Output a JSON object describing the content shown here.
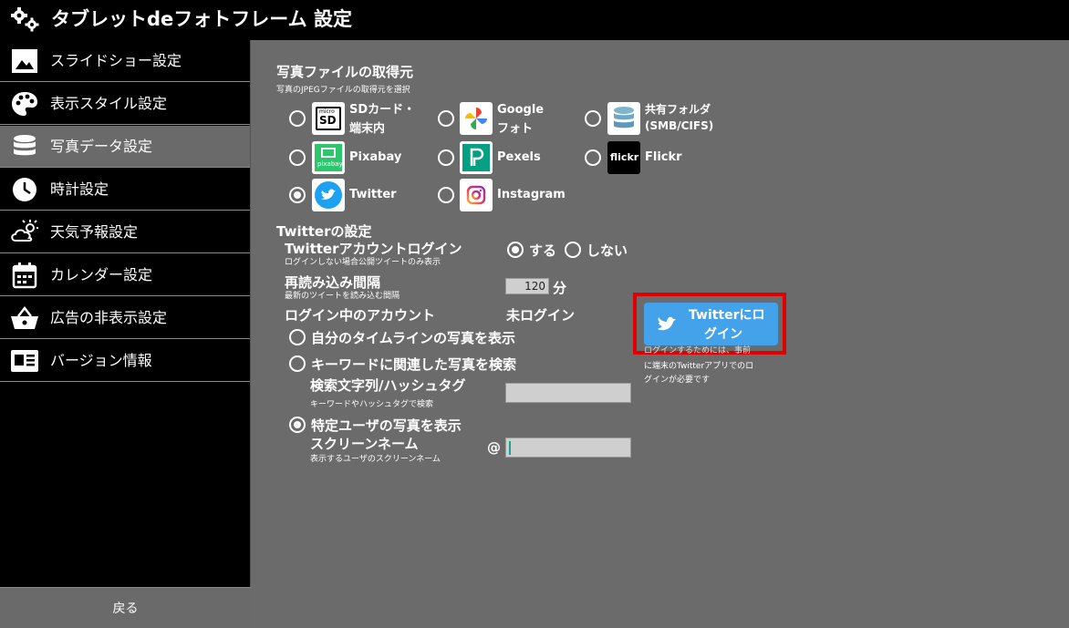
{
  "window": {
    "title": "タブレットdeフォトフレーム 設定"
  },
  "sidebar": {
    "items": [
      {
        "label": "スライドショー設定",
        "icon": "image-icon"
      },
      {
        "label": "表示スタイル設定",
        "icon": "palette-icon"
      },
      {
        "label": "写真データ設定",
        "icon": "database-icon"
      },
      {
        "label": "時計設定",
        "icon": "clock-icon"
      },
      {
        "label": "天気予報設定",
        "icon": "weather-icon"
      },
      {
        "label": "カレンダー設定",
        "icon": "calendar-icon"
      },
      {
        "label": "広告の非表示設定",
        "icon": "basket-icon"
      },
      {
        "label": "バージョン情報",
        "icon": "info-card-icon"
      }
    ],
    "back_label": "戻る"
  },
  "source": {
    "title": "写真ファイルの取得元",
    "subtitle": "写真のJPEGファイルの取得元を選択",
    "options": [
      {
        "line1": "SDカード・",
        "line2": "端末内",
        "icon": "sd-card-icon",
        "selected": false
      },
      {
        "line1": "Google",
        "line2": "フォト",
        "icon": "google-photos-icon",
        "selected": false
      },
      {
        "line1": "共有フォルダ",
        "line2": "(SMB/CIFS)",
        "icon": "shared-folder-icon",
        "selected": false
      },
      {
        "line1": "Pixabay",
        "icon": "pixabay-icon",
        "selected": false
      },
      {
        "line1": "Pexels",
        "icon": "pexels-icon",
        "selected": false
      },
      {
        "line1": "Flickr",
        "icon": "flickr-icon",
        "selected": false
      },
      {
        "line1": "Twitter",
        "icon": "twitter-icon",
        "selected": true
      },
      {
        "line1": "Instagram",
        "icon": "instagram-icon",
        "selected": false
      }
    ],
    "sd_tile_text": {
      "top": "micro",
      "main": "SD"
    },
    "pixabay_tile_text": "pixabay",
    "flickr_tile_text": "flickr"
  },
  "twitter": {
    "section_title": "Twitterの設定",
    "account_login": {
      "label": "Twitterアカウントログイン",
      "sub": "ログインしない場合公開ツイートのみ表示",
      "yes": "する",
      "no": "しない",
      "selected": "yes"
    },
    "reload": {
      "label": "再読み込み間隔",
      "sub": "最新のツイートを読み込む間隔",
      "value": "120",
      "unit": "分"
    },
    "current_account": {
      "label": "ログイン中のアカウント",
      "value": "未ログイン"
    },
    "mode_timeline": "自分のタイムラインの写真を表示",
    "mode_keyword": "キーワードに関連した写真を検索",
    "search": {
      "label": "検索文字列/ハッシュタグ",
      "sub": "キーワードやハッシュタグで検索",
      "value": ""
    },
    "mode_user": "特定ユーザの写真を表示",
    "screen_name": {
      "label": "スクリーンネーム",
      "sub": "表示するユーザのスクリーンネーム",
      "prefix": "@",
      "value": ""
    },
    "selected_mode": "user",
    "login_button": {
      "line1": "Twitterにロ",
      "line2": "グイン"
    },
    "login_note": {
      "line1": "ログインするためには、事前",
      "line2": "に端末のTwitterアプリでのロ",
      "line3": "グインが必要です"
    }
  },
  "colors": {
    "twitter_blue": "#43a2ea",
    "highlight_red": "#e00000",
    "panel_gray": "#6b6b6b"
  }
}
